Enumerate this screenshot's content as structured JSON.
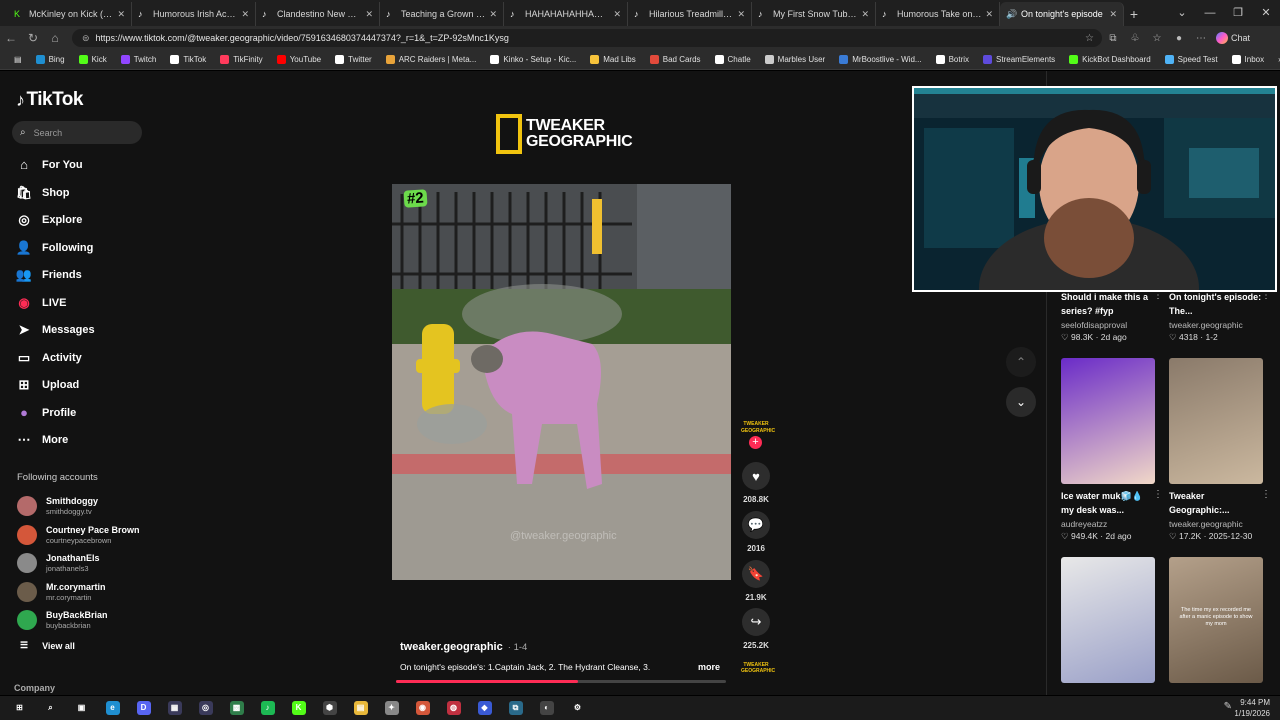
{
  "browser": {
    "tabs": [
      {
        "title": "McKinley on Kick (@mckinleyjr)",
        "icon": "kick-icon",
        "color": "#53fc18"
      },
      {
        "title": "Humorous Irish Accent Joke",
        "icon": "tiktok-icon",
        "color": "#ffffff"
      },
      {
        "title": "Clandestino New York: Bicycle",
        "icon": "tiktok-icon",
        "color": "#ffffff"
      },
      {
        "title": "Teaching a Grown Man How",
        "icon": "tiktok-icon",
        "color": "#ffffff"
      },
      {
        "title": "HAHAHAHAHHAHA #fyp",
        "icon": "tiktok-icon",
        "color": "#ffffff"
      },
      {
        "title": "Hilarious Treadmill Fails Th",
        "icon": "tiktok-icon",
        "color": "#ffffff"
      },
      {
        "title": "My First Snow Tubing Expe",
        "icon": "tiktok-icon",
        "color": "#ffffff"
      },
      {
        "title": "Humorous Take on the Nu",
        "icon": "tiktok-icon",
        "color": "#ffffff"
      },
      {
        "title": "On tonight's episode",
        "icon": "speaker-icon",
        "color": "#ffffff",
        "active": true
      }
    ],
    "url": "https://www.tiktok.com/@tweaker.geographic/video/7591634680374447374?_r=1&_t=ZP-92sMnc1Kysg",
    "chat_label": "Chat",
    "bookmarks": [
      {
        "label": "Bing",
        "color": "#1f8fd1"
      },
      {
        "label": "Kick",
        "color": "#53fc18"
      },
      {
        "label": "Twitch",
        "color": "#9146ff"
      },
      {
        "label": "TikTok",
        "color": "#ffffff"
      },
      {
        "label": "TikFinity",
        "color": "#ff3b5c"
      },
      {
        "label": "YouTube",
        "color": "#ff0000"
      },
      {
        "label": "Twitter",
        "color": "#ffffff"
      },
      {
        "label": "ARC Raiders | Meta...",
        "color": "#e8a33a"
      },
      {
        "label": "Kinko - Setup - Kic...",
        "color": "#ffffff"
      },
      {
        "label": "Mad Libs",
        "color": "#f6c33b"
      },
      {
        "label": "Bad Cards",
        "color": "#e24a3b"
      },
      {
        "label": "Chatle",
        "color": "#ffffff"
      },
      {
        "label": "Marbles User",
        "color": "#cccccc"
      },
      {
        "label": "MrBoostlive - Wid...",
        "color": "#3a7bd5"
      },
      {
        "label": "Botrix",
        "color": "#ffffff"
      },
      {
        "label": "StreamElements",
        "color": "#5e4bdc"
      },
      {
        "label": "KickBot Dashboard",
        "color": "#53fc18"
      },
      {
        "label": "Speed Test",
        "color": "#4fb3f6"
      },
      {
        "label": "Inbox",
        "color": "#ffffff"
      }
    ]
  },
  "tiktok": {
    "logo": "TikTok",
    "search_placeholder": "Search",
    "nav": [
      {
        "label": "For You",
        "icon": "home-icon",
        "glyph": "⌂"
      },
      {
        "label": "Shop",
        "icon": "shopping-bag-icon",
        "glyph": "🛍"
      },
      {
        "label": "Explore",
        "icon": "compass-icon",
        "glyph": "◎"
      },
      {
        "label": "Following",
        "icon": "person-check-icon",
        "glyph": "👤"
      },
      {
        "label": "Friends",
        "icon": "friends-icon",
        "glyph": "👥"
      },
      {
        "label": "LIVE",
        "icon": "live-icon",
        "glyph": "◉"
      },
      {
        "label": "Messages",
        "icon": "send-icon",
        "glyph": "➤"
      },
      {
        "label": "Activity",
        "icon": "inbox-icon",
        "glyph": "▭"
      },
      {
        "label": "Upload",
        "icon": "plus-box-icon",
        "glyph": "⊞"
      },
      {
        "label": "Profile",
        "icon": "profile-avatar-icon",
        "glyph": "●"
      },
      {
        "label": "More",
        "icon": "more-dots-icon",
        "glyph": "⋯"
      }
    ],
    "following_heading": "Following accounts",
    "following": [
      {
        "name": "Smithdoggy",
        "handle": "smithdoggy.tv",
        "color": "#b46a6a"
      },
      {
        "name": "Courtney Pace Brown",
        "handle": "courtneypacebrown",
        "color": "#d4573a"
      },
      {
        "name": "JonathanEls",
        "handle": "jonathanels3",
        "color": "#8a8a8a"
      },
      {
        "name": "Mr.corymartin",
        "handle": "mr.corymartin",
        "color": "#6b5c4a"
      },
      {
        "name": "BuyBackBrian",
        "handle": "buybackbrian",
        "color": "#2fa84f"
      }
    ],
    "view_all": "View all",
    "company": "Company"
  },
  "video": {
    "brand_line1": "TWEAKER",
    "brand_line2": "GEOGRAPHIC",
    "badge": "#2",
    "watermark": "@tweaker.geographic",
    "creator": "tweaker.geographic",
    "date": "· 1-4",
    "caption": "On tonight's episode's: 1.Captain Jack, 2. The Hydrant Cleanse, 3.",
    "more_label": "more",
    "progress": 0.55,
    "avatar_text": "TWEAKER GEOGRAPHIC",
    "actions": [
      {
        "name": "like",
        "icon": "heart-icon",
        "glyph": "♥",
        "count": "208.8K"
      },
      {
        "name": "comment",
        "icon": "comment-icon",
        "glyph": "💬",
        "count": "2016"
      },
      {
        "name": "save",
        "icon": "bookmark-icon",
        "glyph": "🔖",
        "count": "21.9K"
      },
      {
        "name": "share",
        "icon": "share-icon",
        "glyph": "↪",
        "count": "225.2K"
      }
    ]
  },
  "related": [
    {
      "title": "Should i make this a series? #fyp",
      "user": "seelofdisapproval",
      "likes": "98.3K",
      "when": "2d ago"
    },
    {
      "title": "On tonight's episode: The...",
      "user": "tweaker.geographic",
      "likes": "4318",
      "when": "1-2"
    },
    {
      "title": "Ice water muk🧊💧 my desk was...",
      "user": "audreyeatzz",
      "likes": "949.4K",
      "when": "2d ago"
    },
    {
      "title": "Tweaker Geographic:...",
      "user": "tweaker.geographic",
      "likes": "17.2K",
      "when": "2025-12-30"
    },
    {
      "title": "",
      "user": "",
      "likes": "",
      "when": ""
    },
    {
      "title": "",
      "user": "",
      "likes": "",
      "when": "",
      "overlay": "The time my ex recorded me after a manic episode to show my mom"
    }
  ],
  "taskbar": {
    "time": "9:44 PM",
    "date": "1/19/2026"
  }
}
